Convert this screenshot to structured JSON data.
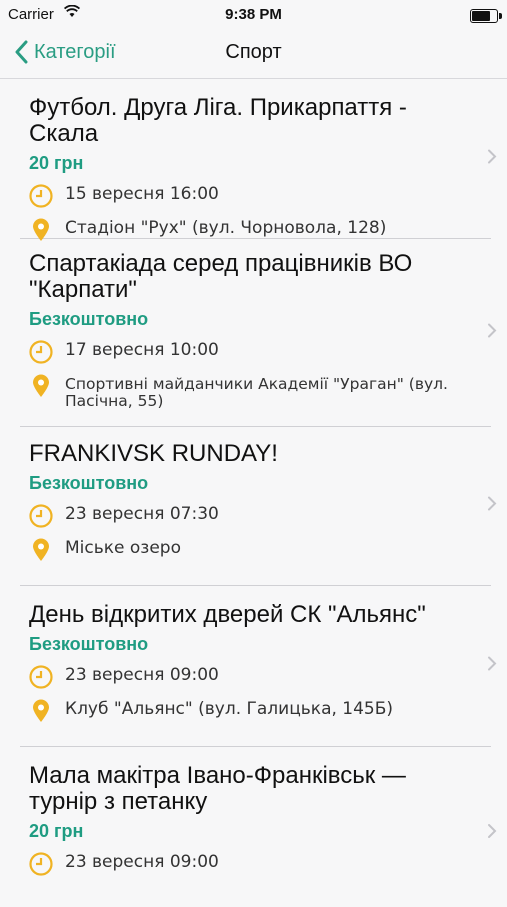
{
  "status_bar": {
    "carrier": "Carrier",
    "time": "9:38 PM"
  },
  "nav": {
    "back_label": "Категорії",
    "title": "Спорт"
  },
  "accent_color": "#2a9d83",
  "events": [
    {
      "title": "Футбол. Друга Ліга. Прикарпаття - Скала",
      "price": "20 грн",
      "date": "15 вересня 16:00",
      "location": "Стадіон \"Рух\" (вул. Чорновола, 128)"
    },
    {
      "title": "Спартакіада серед працівників ВО \"Карпати\"",
      "price": "Безкоштовно",
      "date": "17 вересня 10:00",
      "location": "Спортивні майданчики Академії \"Ураган\" (вул. Пасічна, 55)"
    },
    {
      "title": "FRANKIVSK RUNDAY!",
      "price": "Безкоштовно",
      "date": "23 вересня 07:30",
      "location": "Міське озеро"
    },
    {
      "title": "День відкритих дверей СК \"Альянс\"",
      "price": "Безкоштовно",
      "date": "23 вересня 09:00",
      "location": "Клуб \"Альянс\" (вул. Галицька, 145Б)"
    },
    {
      "title": "Мала макітра Івано-Франківськ — турнір з петанку",
      "price": "20 грн",
      "date": "23 вересня 09:00",
      "location": ""
    }
  ]
}
